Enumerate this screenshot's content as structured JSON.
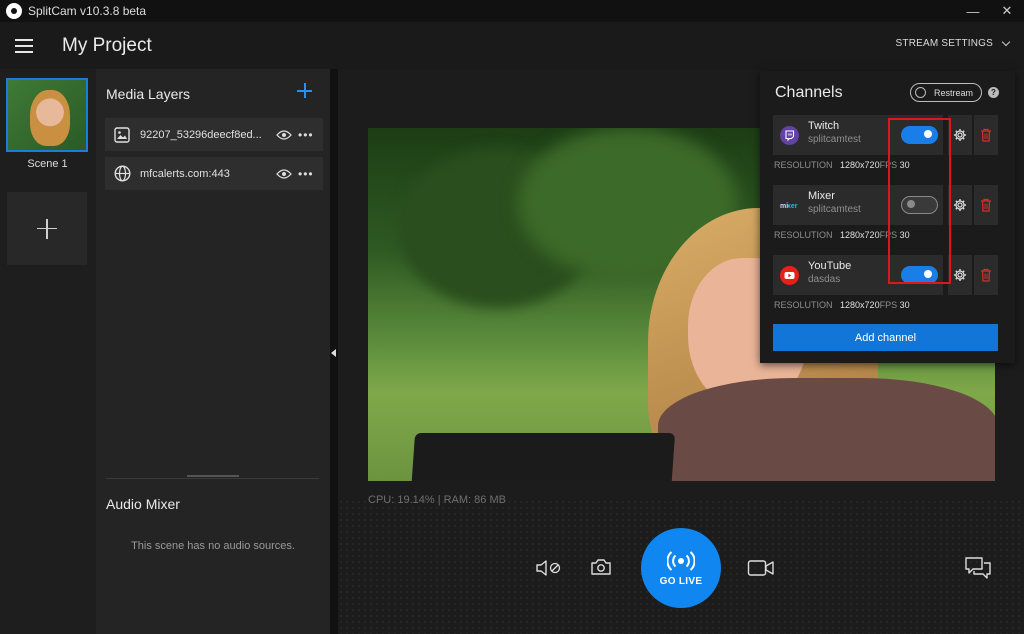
{
  "app": {
    "title": "SplitCam v10.3.8 beta",
    "win_minimize": "—",
    "win_close": "✕"
  },
  "header": {
    "project_title": "My Project",
    "stream_settings_label": "STREAM SETTINGS"
  },
  "scenes": {
    "items": [
      {
        "label": "Scene 1",
        "selected": true
      }
    ]
  },
  "media_layers": {
    "title": "Media Layers",
    "items": [
      {
        "name": "92207_53296deecf8ed...",
        "icon": "image-icon"
      },
      {
        "name": "mfcalerts.com:443",
        "icon": "globe-icon"
      }
    ]
  },
  "audio_mixer": {
    "title": "Audio Mixer",
    "empty_text": "This scene has no audio sources."
  },
  "status": {
    "cpu_ram": "CPU: 19.14% | RAM: 86 MB"
  },
  "controls": {
    "go_live_label": "GO LIVE"
  },
  "channels_panel": {
    "title": "Channels",
    "restream_label": "Restream",
    "help": "?",
    "resolution_label": "RESOLUTION",
    "fps_label": "FPS",
    "items": [
      {
        "name": "Twitch",
        "user": "splitcamtest",
        "enabled": true,
        "resolution": "1280x720",
        "fps": "30",
        "icon": "twitch-icon"
      },
      {
        "name": "Mixer",
        "user": "splitcamtest",
        "enabled": false,
        "resolution": "1280x720",
        "fps": "30",
        "icon": "mixer-icon"
      },
      {
        "name": "YouTube",
        "user": "dasdas",
        "enabled": true,
        "resolution": "1280x720",
        "fps": "30",
        "icon": "youtube-icon"
      }
    ],
    "add_channel_label": "Add channel"
  },
  "colors": {
    "accent": "#1a7ee8",
    "highlight": "#e0141b",
    "delete": "#d0302a"
  }
}
